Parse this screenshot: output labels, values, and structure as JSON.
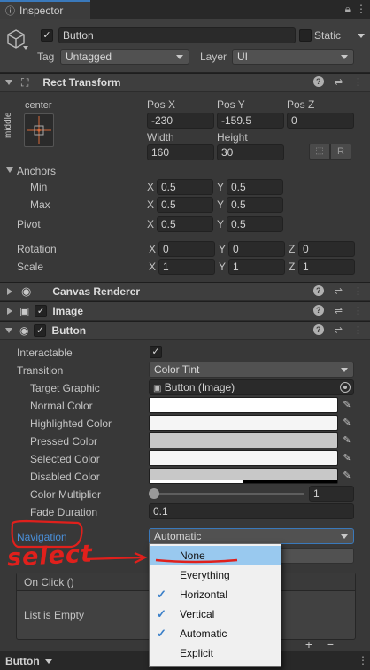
{
  "window": {
    "tab_label": "Inspector"
  },
  "gameobject": {
    "name": "Button",
    "static_label": "Static",
    "tag_label": "Tag",
    "tag_value": "Untagged",
    "layer_label": "Layer",
    "layer_value": "UI"
  },
  "rect_transform": {
    "title": "Rect Transform",
    "anchor_h": "center",
    "anchor_v": "middle",
    "labels": {
      "posx": "Pos X",
      "posy": "Pos Y",
      "posz": "Pos Z",
      "width": "Width",
      "height": "Height"
    },
    "values": {
      "posx": "-230",
      "posy": "-159.5",
      "posz": "0",
      "width": "160",
      "height": "30"
    },
    "r_button": "R",
    "anchors_label": "Anchors",
    "min_label": "Min",
    "max_label": "Max",
    "pivot_label": "Pivot",
    "rotation_label": "Rotation",
    "scale_label": "Scale",
    "axis": {
      "x": "X",
      "y": "Y",
      "z": "Z"
    },
    "min": {
      "x": "0.5",
      "y": "0.5"
    },
    "max": {
      "x": "0.5",
      "y": "0.5"
    },
    "pivot": {
      "x": "0.5",
      "y": "0.5"
    },
    "rotation": {
      "x": "0",
      "y": "0",
      "z": "0"
    },
    "scale": {
      "x": "1",
      "y": "1",
      "z": "1"
    }
  },
  "canvas_renderer": {
    "title": "Canvas Renderer"
  },
  "image": {
    "title": "Image"
  },
  "button": {
    "title": "Button",
    "interactable_label": "Interactable",
    "transition_label": "Transition",
    "transition_value": "Color Tint",
    "target_graphic_label": "Target Graphic",
    "target_graphic_value": "Button (Image)",
    "normal_color_label": "Normal Color",
    "normal_color": "#ffffff",
    "highlighted_color_label": "Highlighted Color",
    "highlighted_color": "#f5f5f5",
    "pressed_color_label": "Pressed Color",
    "pressed_color": "#c8c8c8",
    "selected_color_label": "Selected Color",
    "selected_color": "#f5f5f5",
    "disabled_color_label": "Disabled Color",
    "disabled_color": "#c8c8c8",
    "color_multiplier_label": "Color Multiplier",
    "color_multiplier_value": "1",
    "color_multiplier_fraction": 0.0,
    "fade_duration_label": "Fade Duration",
    "fade_duration_value": "0.1",
    "navigation_label": "Navigation",
    "navigation_value": "Automatic"
  },
  "onclick": {
    "title": "On Click ()",
    "empty_label": "List is Empty",
    "add_label": "+",
    "remove_label": "−"
  },
  "dropdown_menu": {
    "items": [
      {
        "label": "None",
        "checked": false
      },
      {
        "label": "Everything",
        "checked": false
      },
      {
        "label": "Horizontal",
        "checked": true
      },
      {
        "label": "Vertical",
        "checked": true
      },
      {
        "label": "Automatic",
        "checked": true
      },
      {
        "label": "Explicit",
        "checked": false
      }
    ]
  },
  "annotation": {
    "text": "select",
    "color": "#e0201c"
  },
  "footer": {
    "object_label": "Button"
  },
  "colors": {
    "accent": "#3a79bb",
    "link_blue": "#4a8fd9",
    "menu_highlight": "#99c9ef"
  },
  "icons": [
    "cube-icon",
    "lock-icon",
    "menu-icon",
    "question-icon",
    "preset-icon",
    "more-icon",
    "eye-icon",
    "image-icon",
    "radio-icon",
    "eyedropper-icon",
    "target-icon"
  ]
}
